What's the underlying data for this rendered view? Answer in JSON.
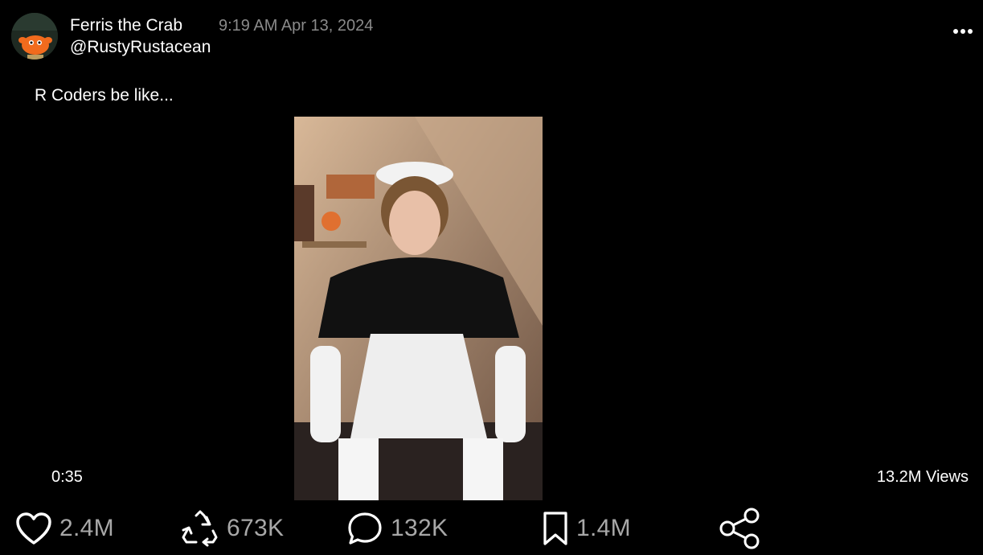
{
  "post": {
    "author": {
      "display_name": "Ferris the Crab",
      "handle": "@RustyRustacean",
      "avatar_icon": "ferris-crab-avatar"
    },
    "timestamp": "9:19 AM Apr 13, 2024",
    "text": "R Coders be like...",
    "more_icon": "ellipsis-icon"
  },
  "video": {
    "duration": "0:35",
    "views": "13.2M Views"
  },
  "actions": {
    "like": {
      "icon": "heart-icon",
      "count": "2.4M"
    },
    "repost": {
      "icon": "recycle-repost-icon",
      "count": "673K"
    },
    "reply": {
      "icon": "speech-bubble-icon",
      "count": "132K"
    },
    "bookmark": {
      "icon": "bookmark-icon",
      "count": "1.4M"
    },
    "share": {
      "icon": "share-icon"
    }
  },
  "colors": {
    "background": "#000000",
    "primary_text": "#ffffff",
    "secondary_text": "#8a8a8a",
    "action_text": "#a8a8a8"
  }
}
